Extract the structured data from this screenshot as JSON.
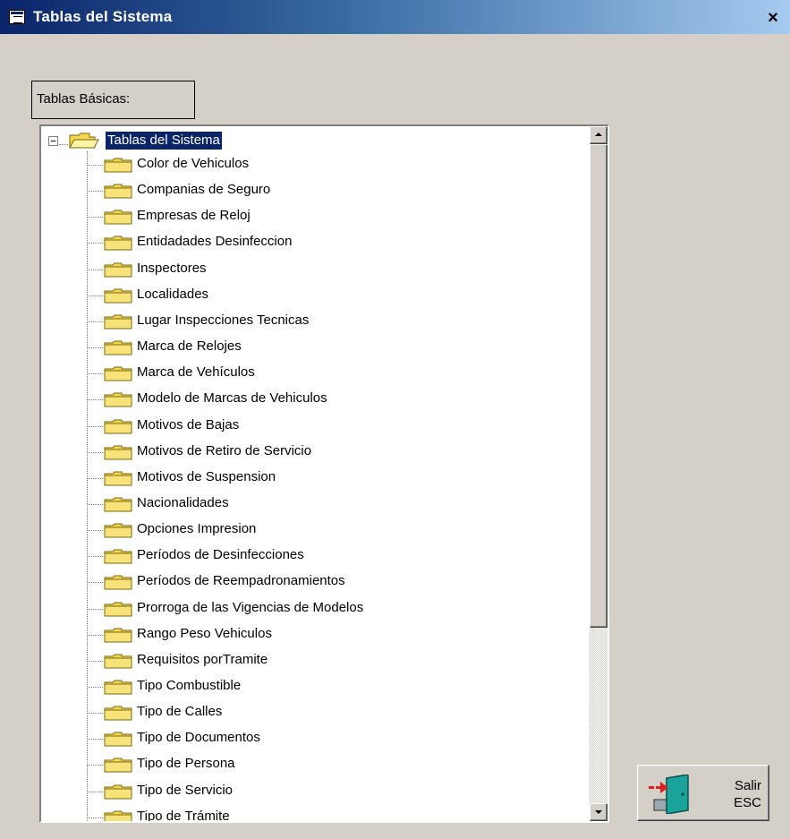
{
  "window": {
    "title": "Tablas del Sistema",
    "close_glyph": "×"
  },
  "group": {
    "label": "Tablas Básicas:"
  },
  "tree": {
    "root_label": "Tablas del Sistema",
    "expander_glyph": "−",
    "items": [
      "Color de Vehiculos",
      "Companias de Seguro",
      "Empresas de Reloj",
      "Entidadades Desinfeccion",
      "Inspectores",
      "Localidades",
      "Lugar Inspecciones Tecnicas",
      "Marca de Relojes",
      "Marca de Vehículos",
      "Modelo de Marcas de Vehiculos",
      "Motivos de Bajas",
      "Motivos de Retiro de Servicio",
      "Motivos de Suspension",
      "Nacionalidades",
      "Opciones Impresion",
      "Períodos de Desinfecciones",
      "Períodos de Reempadronamientos",
      "Prorroga de las Vigencias de Modelos",
      "Rango Peso Vehiculos",
      "Requisitos porTramite",
      "Tipo Combustible",
      "Tipo de Calles",
      "Tipo de Documentos",
      "Tipo de Persona",
      "Tipo de Servicio",
      "Tipo de Trámite"
    ],
    "selected_color": "#0a246a",
    "folder_color": "#f5d64e",
    "icon": "folder-icon"
  },
  "exit_button": {
    "line1": "Salir",
    "line2": "ESC",
    "icon": "exit-door-icon"
  }
}
